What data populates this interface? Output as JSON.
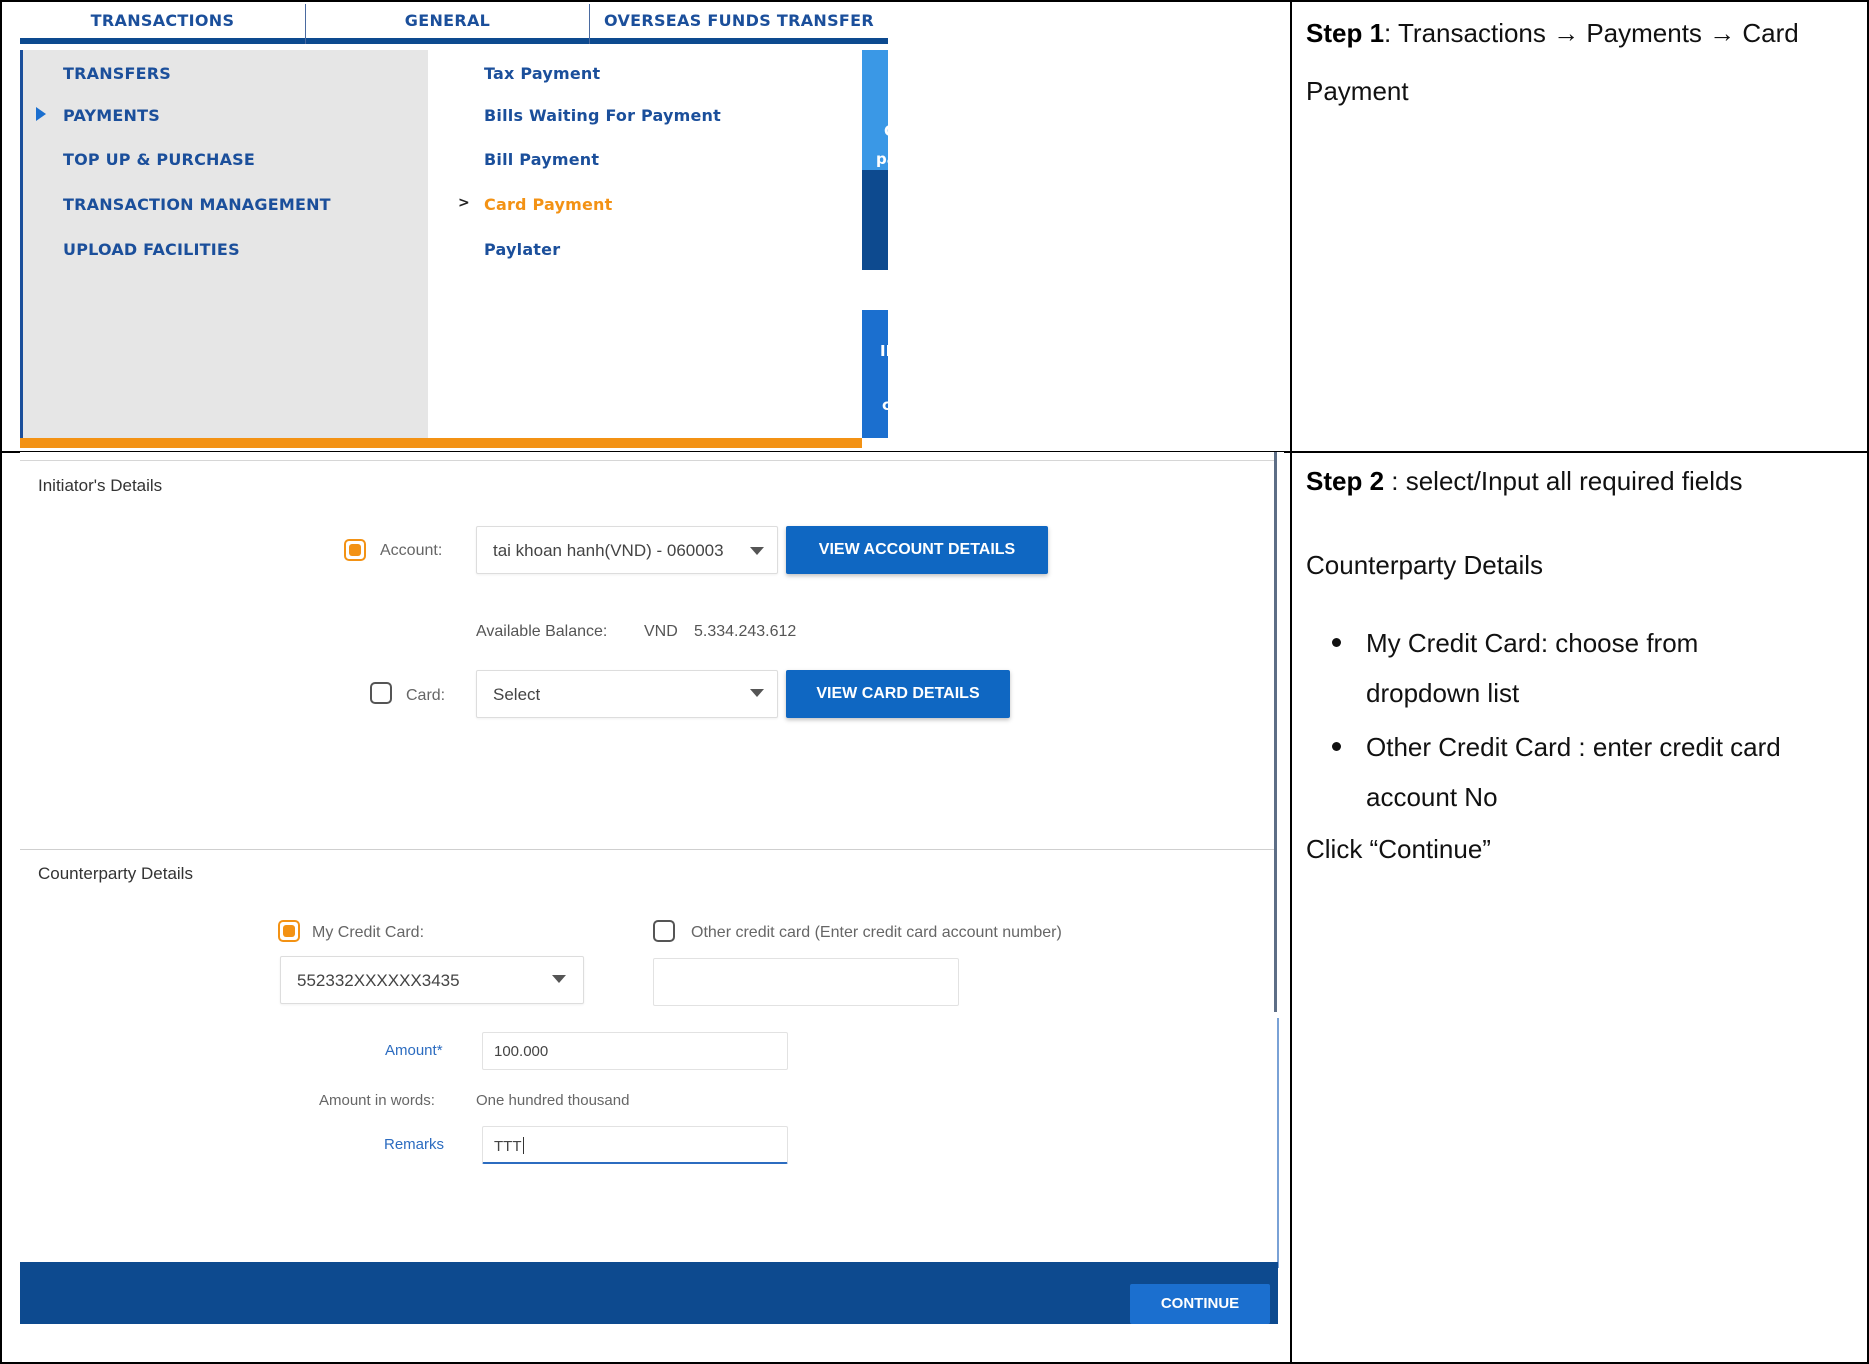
{
  "menu": {
    "tabs": [
      "TRANSACTIONS",
      "GENERAL",
      "OVERSEAS FUNDS TRANSFER"
    ],
    "left_items": [
      "TRANSFERS",
      "PAYMENTS",
      "TOP UP & PURCHASE",
      "TRANSACTION MANAGEMENT",
      "UPLOAD FACILITIES"
    ],
    "right_items": [
      "Tax Payment",
      "Bills Waiting For Payment",
      "Bill Payment",
      "Card Payment",
      "Paylater"
    ],
    "selected_left": "PAYMENTS",
    "selected_right": "Card Payment",
    "peek_texts": [
      "Ch",
      "par",
      "IDA",
      "ce"
    ],
    "colors": {
      "primary_blue": "#1b4f9b",
      "active_orange": "#f39214",
      "panel_grey": "#e6e6e6"
    }
  },
  "form": {
    "initiator_title": "Initiator's Details",
    "account_label": "Account:",
    "account_value": "tai khoan hanh(VND)  - 060003",
    "view_account_btn": "VIEW ACCOUNT DETAILS",
    "available_balance_label": "Available Balance:",
    "available_balance_currency": "VND",
    "available_balance_value": "5.334.243.612",
    "card_label": "Card:",
    "card_value": "Select",
    "view_card_btn": "VIEW CARD DETAILS",
    "counterparty_title": "Counterparty Details",
    "my_card_label": "My Credit Card:",
    "my_card_value": "552332XXXXXX3435",
    "other_card_label": "Other credit card (Enter credit card account number)",
    "other_card_value": "",
    "amount_label": "Amount*",
    "amount_value": "100.000",
    "amount_words_label": "Amount in words:",
    "amount_words_value": "One hundred thousand",
    "remarks_label": "Remarks",
    "remarks_value": "TTT",
    "continue_btn": "CONTINUE",
    "account_checked": true,
    "card_checked": false,
    "my_card_checked": true,
    "other_card_checked": false
  },
  "instructions": {
    "step1_label": "Step 1",
    "step1_text": ": Transactions → Payments → Card",
    "step1_text2": "Payment",
    "step2_label": "Step 2",
    "step2_text": " : select/Input all required fields",
    "counterparty_heading": "Counterparty Details",
    "bullets": [
      [
        "My Credit Card: choose from",
        "dropdown list"
      ],
      [
        "Other Credit Card : enter credit card",
        "account No"
      ]
    ],
    "click_text": "Click “Continue”"
  }
}
